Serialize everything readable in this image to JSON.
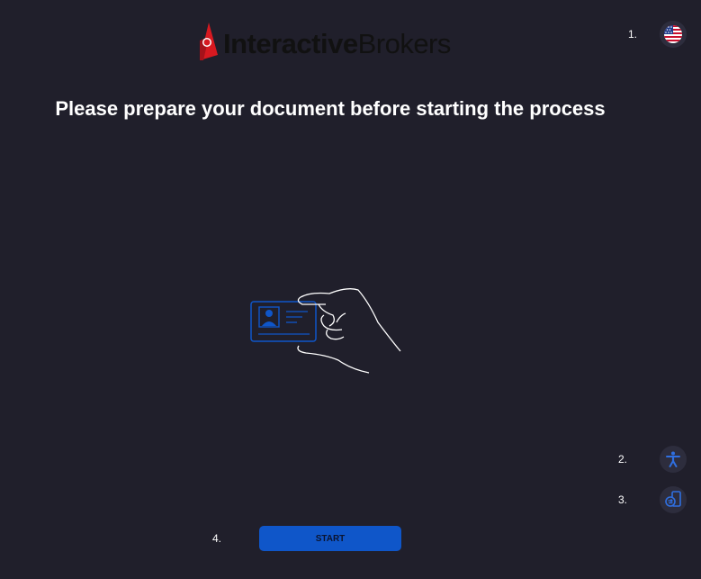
{
  "logo": {
    "text_bold": "Interactive",
    "text_regular": "Brokers",
    "mark_color": "#d71920"
  },
  "title": "Please prepare your document before starting the process",
  "markers": {
    "one": "1.",
    "two": "2.",
    "three": "3.",
    "four": "4."
  },
  "buttons": {
    "language_icon": "us-flag-icon",
    "accessibility_icon": "accessibility-icon",
    "switch_device_icon": "switch-device-icon",
    "start_label": "START"
  },
  "colors": {
    "background": "#201f2b",
    "accent": "#0f56c9",
    "round_button": "#2d2d3d"
  }
}
